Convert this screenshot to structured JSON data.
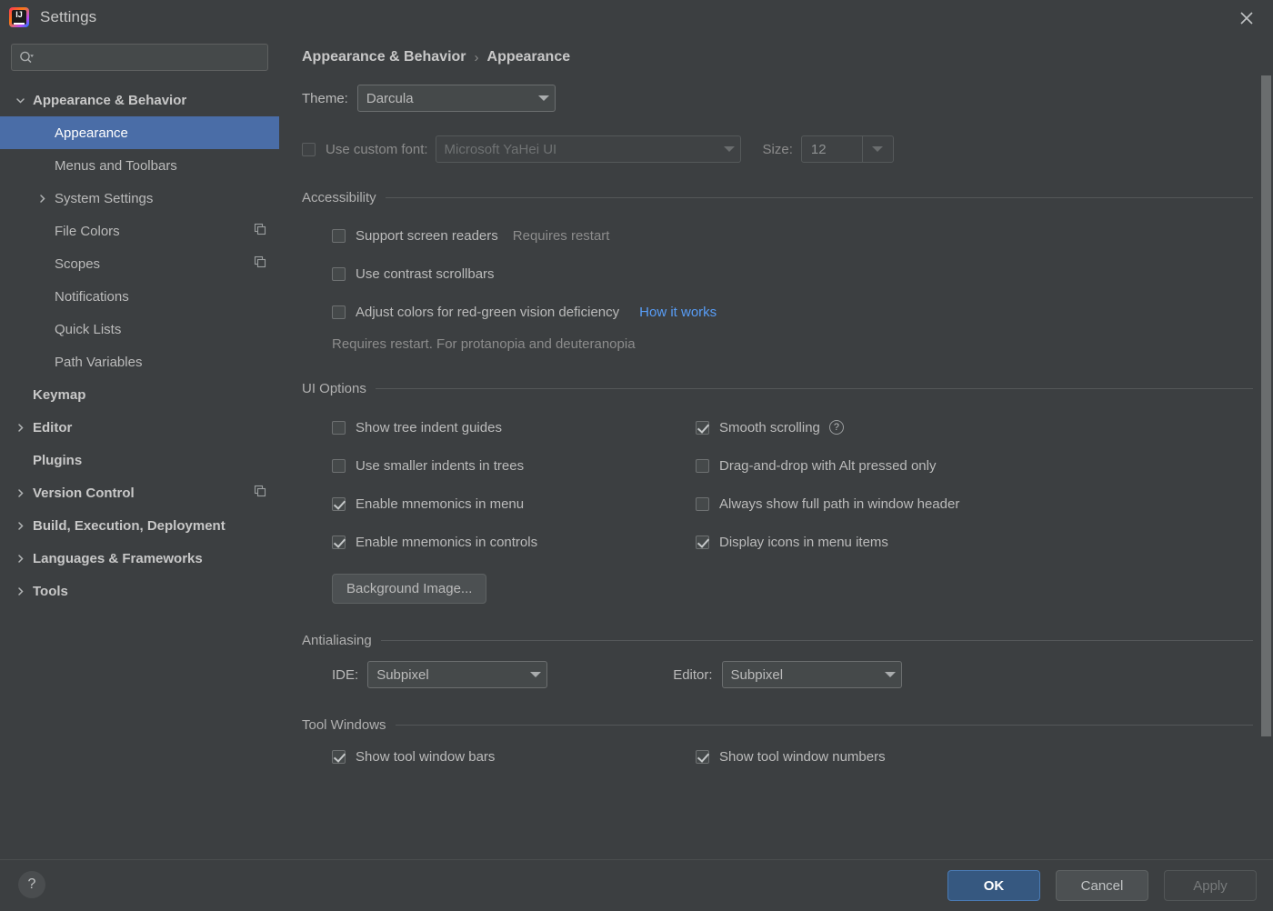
{
  "window": {
    "title": "Settings",
    "logo_text": "IJ",
    "close_icon": "close-icon"
  },
  "sidebar": {
    "search": {
      "placeholder": "",
      "value": "",
      "icon": "search-icon"
    },
    "items": [
      {
        "label": "Appearance & Behavior",
        "level": 0,
        "bold": true,
        "chevron": "down",
        "selected": false,
        "copy": false
      },
      {
        "label": "Appearance",
        "level": 1,
        "bold": false,
        "chevron": "none",
        "selected": true,
        "copy": false
      },
      {
        "label": "Menus and Toolbars",
        "level": 1,
        "bold": false,
        "chevron": "none",
        "selected": false,
        "copy": false
      },
      {
        "label": "System Settings",
        "level": 1,
        "bold": false,
        "chevron": "right",
        "selected": false,
        "copy": false
      },
      {
        "label": "File Colors",
        "level": 1,
        "bold": false,
        "chevron": "none",
        "selected": false,
        "copy": true
      },
      {
        "label": "Scopes",
        "level": 1,
        "bold": false,
        "chevron": "none",
        "selected": false,
        "copy": true
      },
      {
        "label": "Notifications",
        "level": 1,
        "bold": false,
        "chevron": "none",
        "selected": false,
        "copy": false
      },
      {
        "label": "Quick Lists",
        "level": 1,
        "bold": false,
        "chevron": "none",
        "selected": false,
        "copy": false
      },
      {
        "label": "Path Variables",
        "level": 1,
        "bold": false,
        "chevron": "none",
        "selected": false,
        "copy": false
      },
      {
        "label": "Keymap",
        "level": 0,
        "bold": true,
        "chevron": "none",
        "selected": false,
        "copy": false
      },
      {
        "label": "Editor",
        "level": 0,
        "bold": true,
        "chevron": "right",
        "selected": false,
        "copy": false
      },
      {
        "label": "Plugins",
        "level": 0,
        "bold": true,
        "chevron": "none",
        "selected": false,
        "copy": false
      },
      {
        "label": "Version Control",
        "level": 0,
        "bold": true,
        "chevron": "right",
        "selected": false,
        "copy": true
      },
      {
        "label": "Build, Execution, Deployment",
        "level": 0,
        "bold": true,
        "chevron": "right",
        "selected": false,
        "copy": false
      },
      {
        "label": "Languages & Frameworks",
        "level": 0,
        "bold": true,
        "chevron": "right",
        "selected": false,
        "copy": false
      },
      {
        "label": "Tools",
        "level": 0,
        "bold": true,
        "chevron": "right",
        "selected": false,
        "copy": false
      }
    ]
  },
  "breadcrumb": {
    "parent": "Appearance & Behavior",
    "separator": "›",
    "current": "Appearance"
  },
  "theme": {
    "label": "Theme:",
    "value": "Darcula"
  },
  "custom_font": {
    "checkbox_label": "Use custom font:",
    "checked": false,
    "enabled": false,
    "font_value": "Microsoft YaHei UI",
    "size_label": "Size:",
    "size_value": "12"
  },
  "accessibility": {
    "title": "Accessibility",
    "options": [
      {
        "label": "Support screen readers",
        "checked": false,
        "hint": "Requires restart",
        "link": ""
      },
      {
        "label": "Use contrast scrollbars",
        "checked": false,
        "hint": "",
        "link": ""
      },
      {
        "label": "Adjust colors for red-green vision deficiency",
        "checked": false,
        "hint": "",
        "link": "How it works"
      }
    ],
    "note": "Requires restart. For protanopia and deuteranopia"
  },
  "ui_options": {
    "title": "UI Options",
    "left_column": [
      {
        "label": "Show tree indent guides",
        "checked": false,
        "help": false
      },
      {
        "label": "Use smaller indents in trees",
        "checked": false,
        "help": false
      },
      {
        "label": "Enable mnemonics in menu",
        "checked": true,
        "help": false
      },
      {
        "label": "Enable mnemonics in controls",
        "checked": true,
        "help": false
      }
    ],
    "right_column": [
      {
        "label": "Smooth scrolling",
        "checked": true,
        "help": true
      },
      {
        "label": "Drag-and-drop with Alt pressed only",
        "checked": false,
        "help": false
      },
      {
        "label": "Always show full path in window header",
        "checked": false,
        "help": false
      },
      {
        "label": "Display icons in menu items",
        "checked": true,
        "help": false
      }
    ],
    "background_image_button": "Background Image..."
  },
  "antialiasing": {
    "title": "Antialiasing",
    "ide_label": "IDE:",
    "ide_value": "Subpixel",
    "editor_label": "Editor:",
    "editor_value": "Subpixel"
  },
  "tool_windows": {
    "title": "Tool Windows",
    "left": {
      "label": "Show tool window bars",
      "checked": true
    },
    "right": {
      "label": "Show tool window numbers",
      "checked": true
    }
  },
  "footer": {
    "help_label": "?",
    "ok": "OK",
    "cancel": "Cancel",
    "apply": "Apply",
    "apply_enabled": false
  },
  "colors": {
    "window_bg": "#3c3f41",
    "selection_blue": "#4a6da7",
    "link_blue": "#589df6",
    "primary_button": "#365880",
    "text": "#bbbbbb",
    "dim_text": "#8c8c8c"
  }
}
